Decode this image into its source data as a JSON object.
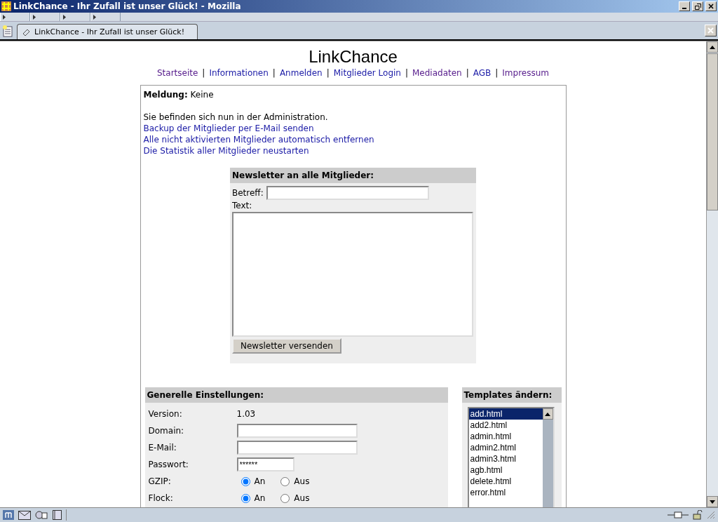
{
  "window": {
    "title": "LinkChance - Ihr Zufall ist unser Glück! - Mozilla"
  },
  "tabs": [
    {
      "label": "LinkChance - Ihr Zufall ist unser Glück!",
      "selected": true
    }
  ],
  "page": {
    "heading": "LinkChance",
    "nav_separator": "|",
    "nav": [
      {
        "label": "Startseite",
        "visited": true
      },
      {
        "label": "Informationen",
        "visited": false
      },
      {
        "label": "Anmelden",
        "visited": false
      },
      {
        "label": "Mitglieder Login",
        "visited": false
      },
      {
        "label": "Mediadaten",
        "visited": true
      },
      {
        "label": "AGB",
        "visited": false
      },
      {
        "label": "Impressum",
        "visited": true
      }
    ],
    "message": "**Meldung:** Keine",
    "intro": "Sie befinden sich nun in der Administration.",
    "admin_links": [
      "Backup der Mitglieder per E-Mail senden",
      "Alle nicht aktivierten Mitglieder automatisch entfernen",
      "Die Statistik aller Mitglieder neustarten"
    ],
    "newsletter": {
      "title": "Newsletter an alle Mitglieder:",
      "subject_label": "Betreff:",
      "text_label": "Text:",
      "button": "Newsletter versenden"
    },
    "settings": {
      "title": "Generelle Einstellungen:",
      "rows": [
        {
          "kind": "text",
          "label": "Version:",
          "value": "1.03"
        },
        {
          "kind": "input",
          "label": "Domain:"
        },
        {
          "kind": "input",
          "label": "E-Mail:"
        },
        {
          "kind": "password",
          "label": "Passwort:",
          "value": "******"
        },
        {
          "kind": "radio",
          "label": "GZIP:",
          "options": [
            {
              "label": "An",
              "selected": true
            },
            {
              "label": "Aus",
              "selected": false
            }
          ]
        },
        {
          "kind": "radio",
          "label": "Flock:",
          "options": [
            {
              "label": "An",
              "selected": true
            },
            {
              "label": "Aus",
              "selected": false
            }
          ]
        }
      ]
    },
    "templates": {
      "title": "Templates ändern:",
      "items": [
        {
          "label": "add.html",
          "selected": true
        },
        {
          "label": "add2.html",
          "selected": false
        },
        {
          "label": "admin.html",
          "selected": false
        },
        {
          "label": "admin2.html",
          "selected": false
        },
        {
          "label": "admin3.html",
          "selected": false
        },
        {
          "label": "agb.html",
          "selected": false
        },
        {
          "label": "delete.html",
          "selected": false
        },
        {
          "label": "error.html",
          "selected": false
        }
      ]
    }
  }
}
